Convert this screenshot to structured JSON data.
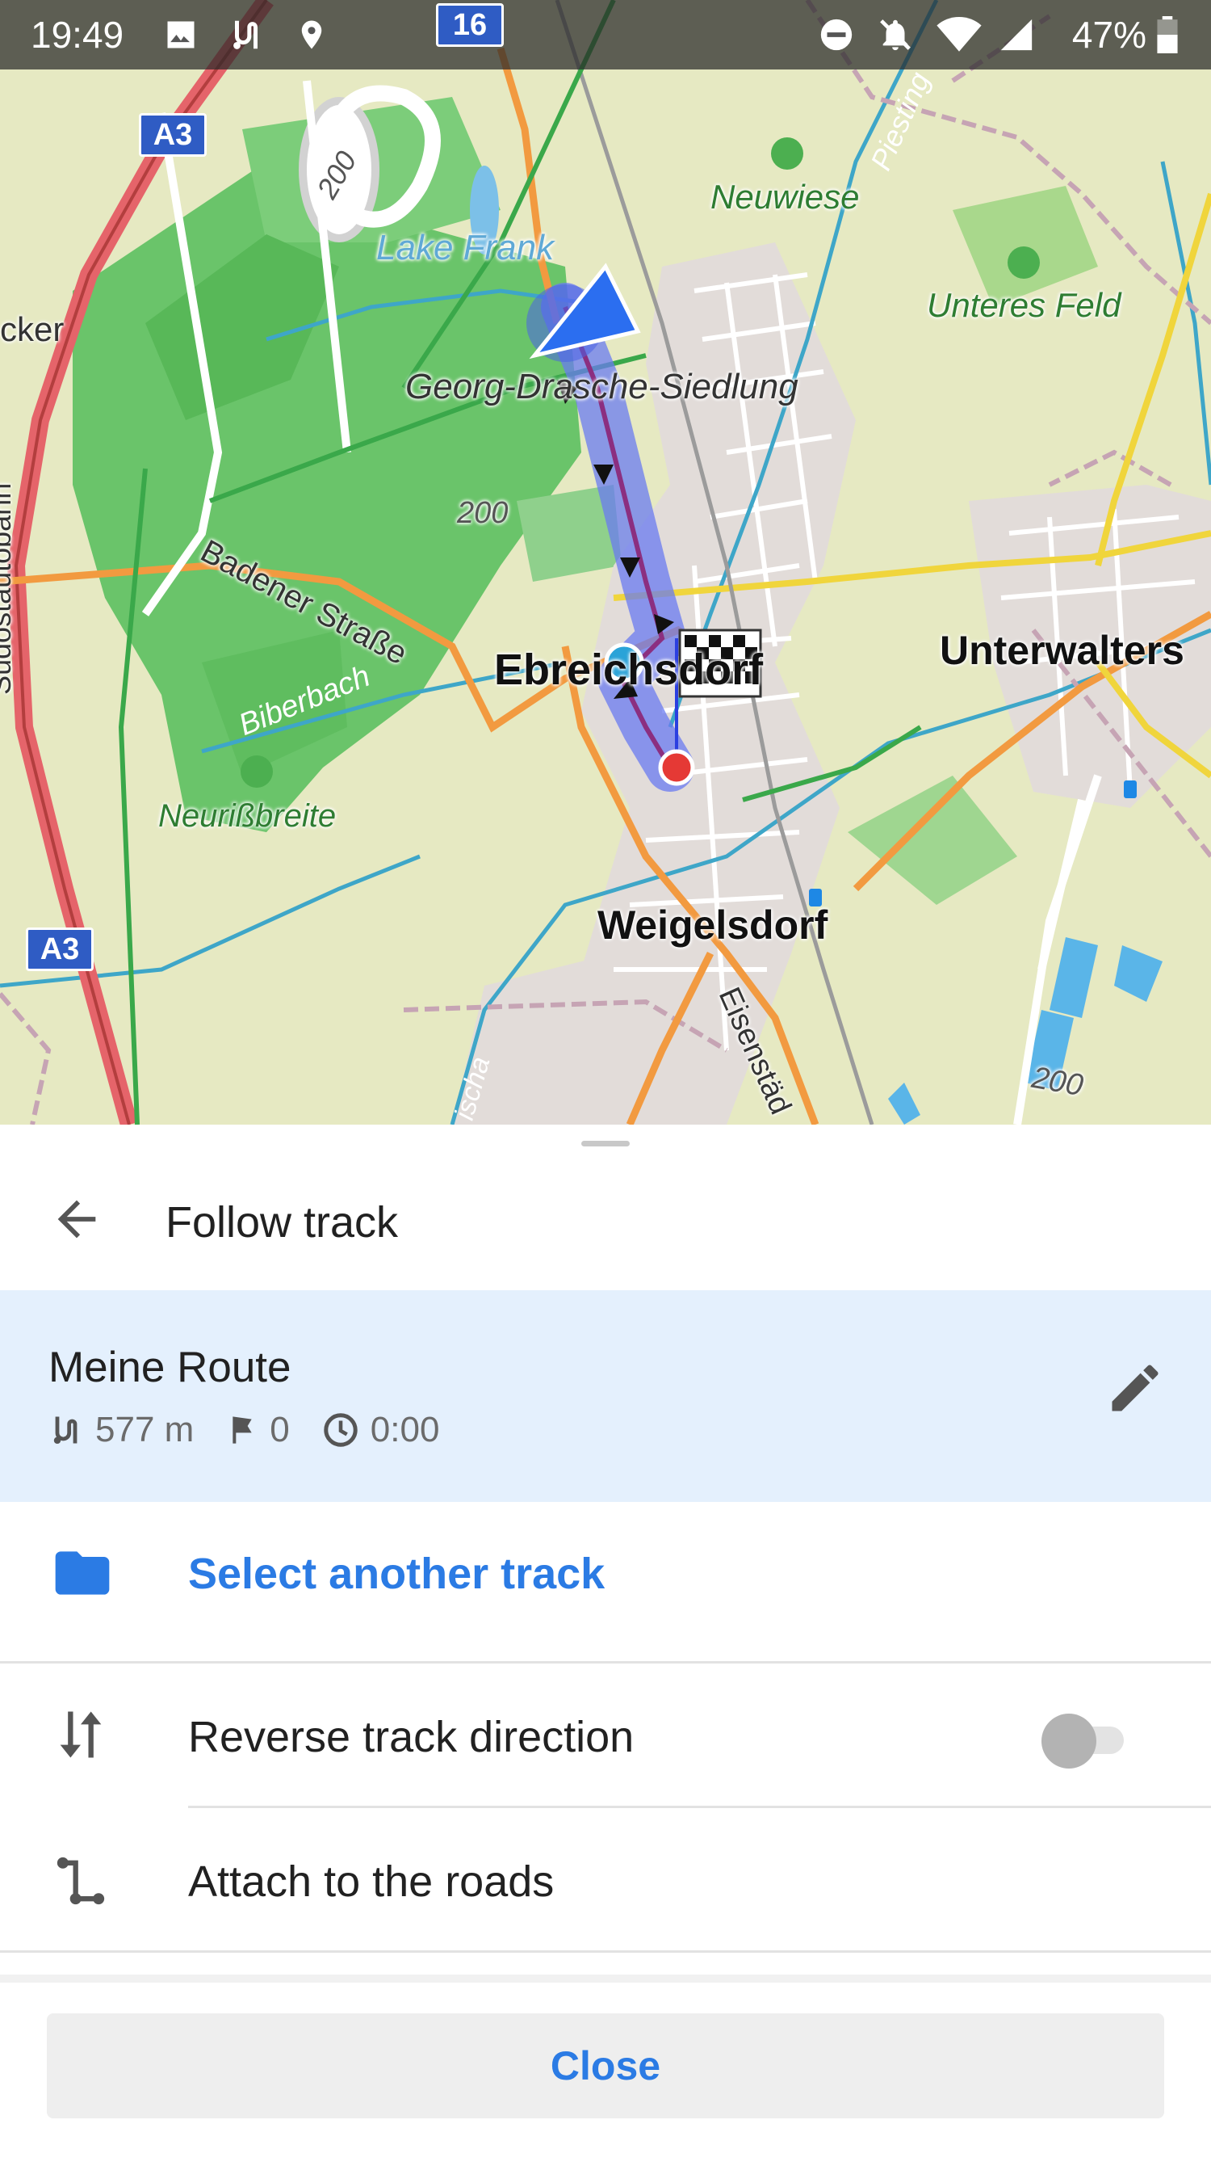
{
  "status_bar": {
    "time": "19:49",
    "battery": "47%",
    "icons": [
      "image-icon",
      "route-icon",
      "location-pin-icon",
      "do-not-disturb-icon",
      "notifications-off-icon",
      "wifi-icon",
      "cell-signal-icon",
      "battery-icon"
    ]
  },
  "map": {
    "labels": {
      "lake_frank": "Lake Frank",
      "neuwiese": "Neuwiese",
      "unteres_feld": "Unteres Feld",
      "georg": "Georg-Drasche-Siedlung",
      "badener": "Badener Straße",
      "ebreichsdorf": "Ebreichsdorf",
      "unterwalters": "Unterwalters",
      "biberbach": "Biberbach",
      "neurissbreite": "Neurißbreite",
      "weigelsdorf": "Weigelsdorf",
      "eisenstadt": "Eisenstäd",
      "piesting": "Piesting",
      "suedautobahn": "Südostautobahn",
      "cker": "cker",
      "fischa": "ischa",
      "alt_200a": "200",
      "alt_200b": "200",
      "alt_200c": "200"
    },
    "shields": {
      "a3_top": "A3",
      "a3_bottom": "A3",
      "road_16": "16"
    }
  },
  "sheet": {
    "title": "Follow track",
    "track": {
      "name": "Meine Route",
      "distance": "577 m",
      "waypoints": "0",
      "time": "0:00"
    },
    "select_track_label": "Select another track",
    "reverse_label": "Reverse track direction",
    "reverse_enabled": "false",
    "attach_label": "Attach to the roads",
    "close_label": "Close"
  },
  "colors": {
    "accent": "#2b7be4",
    "track_card_bg": "#e4f0fd",
    "route_highlight": "#5b6ff0",
    "forest": "#5bbf5b"
  }
}
